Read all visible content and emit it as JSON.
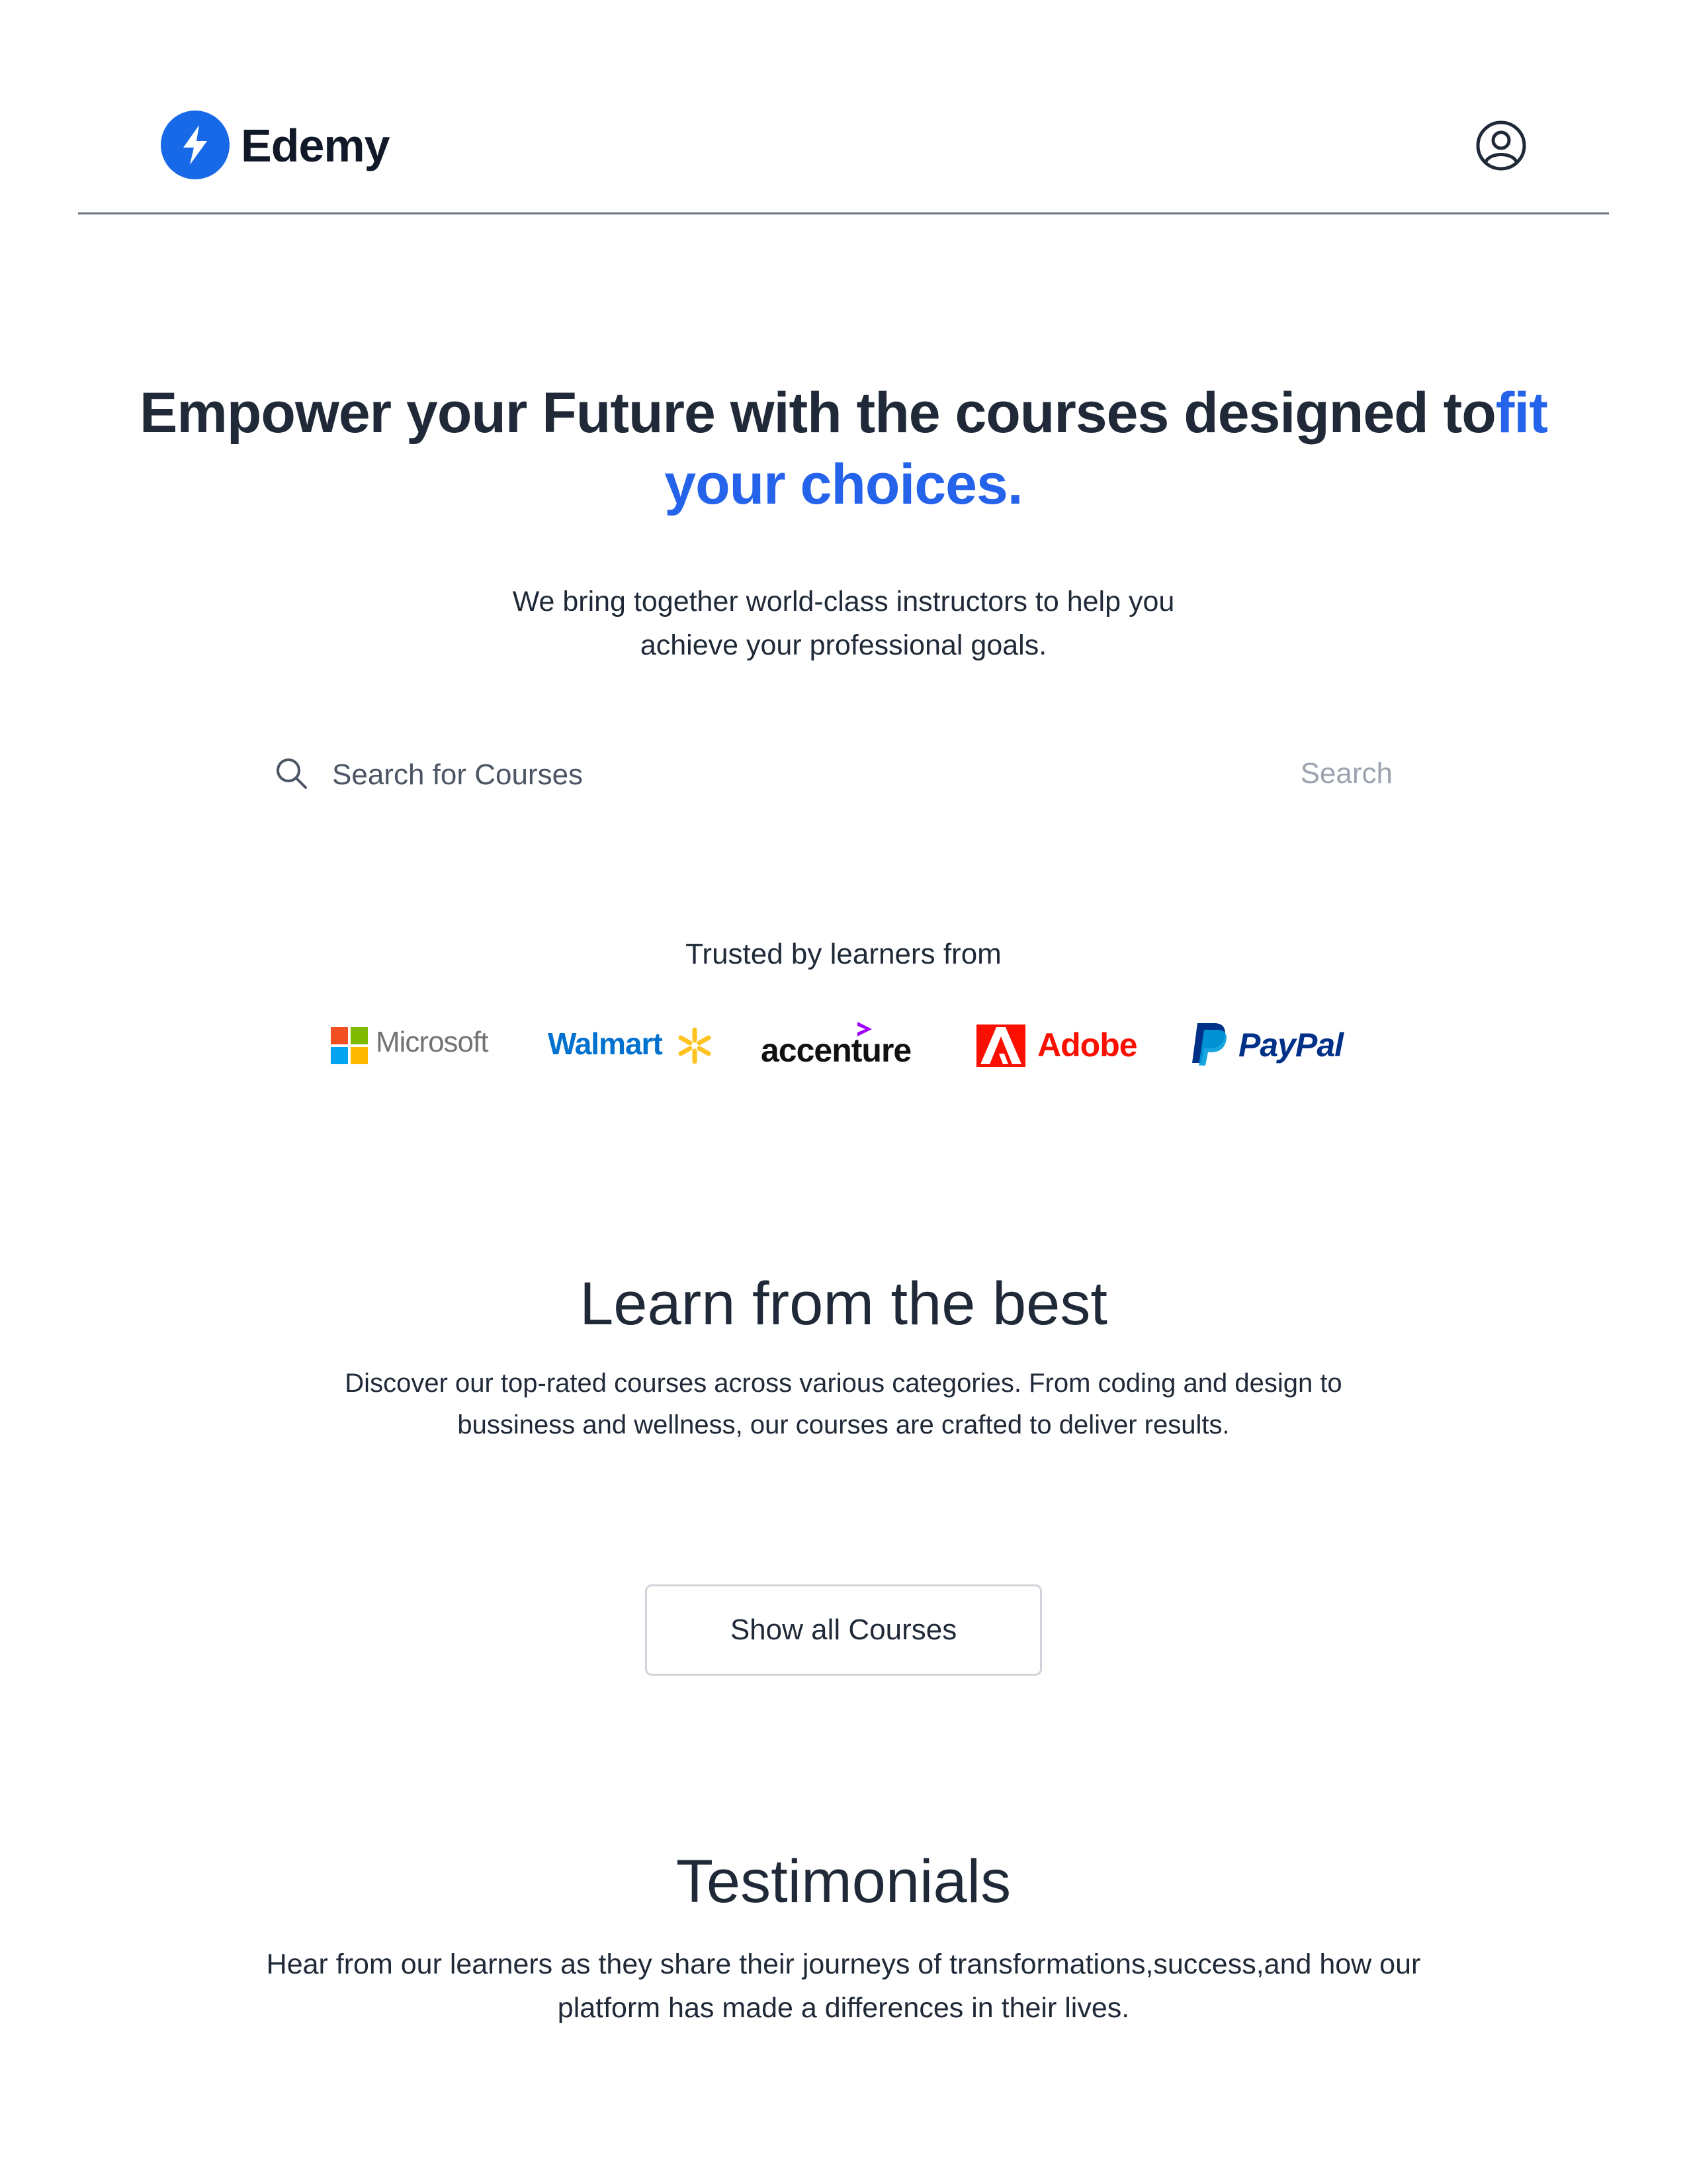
{
  "header": {
    "brand": "Edemy",
    "brand_color": "#1769e8",
    "profile_icon": "user-circle-icon"
  },
  "hero": {
    "title_main": "Empower your Future with the courses designed to",
    "title_accent_inline": "fit",
    "title_accent_line2": "your choices.",
    "accent_color": "#2563eb",
    "subtitle_line1": "We bring together world-class instructors to help you",
    "subtitle_line2": "achieve your professional goals."
  },
  "search": {
    "icon": "search-icon",
    "placeholder": "Search for Courses",
    "button_label": "Search"
  },
  "trusted": {
    "heading": "Trusted by learners from",
    "companies": [
      "Microsoft",
      "Walmart",
      "accenture",
      "Adobe",
      "PayPal"
    ]
  },
  "learn": {
    "title": "Learn from the best",
    "subtitle_line1": "Discover our top-rated courses across various categories. From coding and design to",
    "subtitle_line2": "bussiness and wellness, our courses are crafted to deliver results.",
    "button_label": "Show all Courses"
  },
  "testimonials": {
    "title": "Testimonials",
    "subtitle_line1": "Hear from our learners as they share their journeys of transformations,success,and how our",
    "subtitle_line2": "platform has made a differences in their lives."
  }
}
